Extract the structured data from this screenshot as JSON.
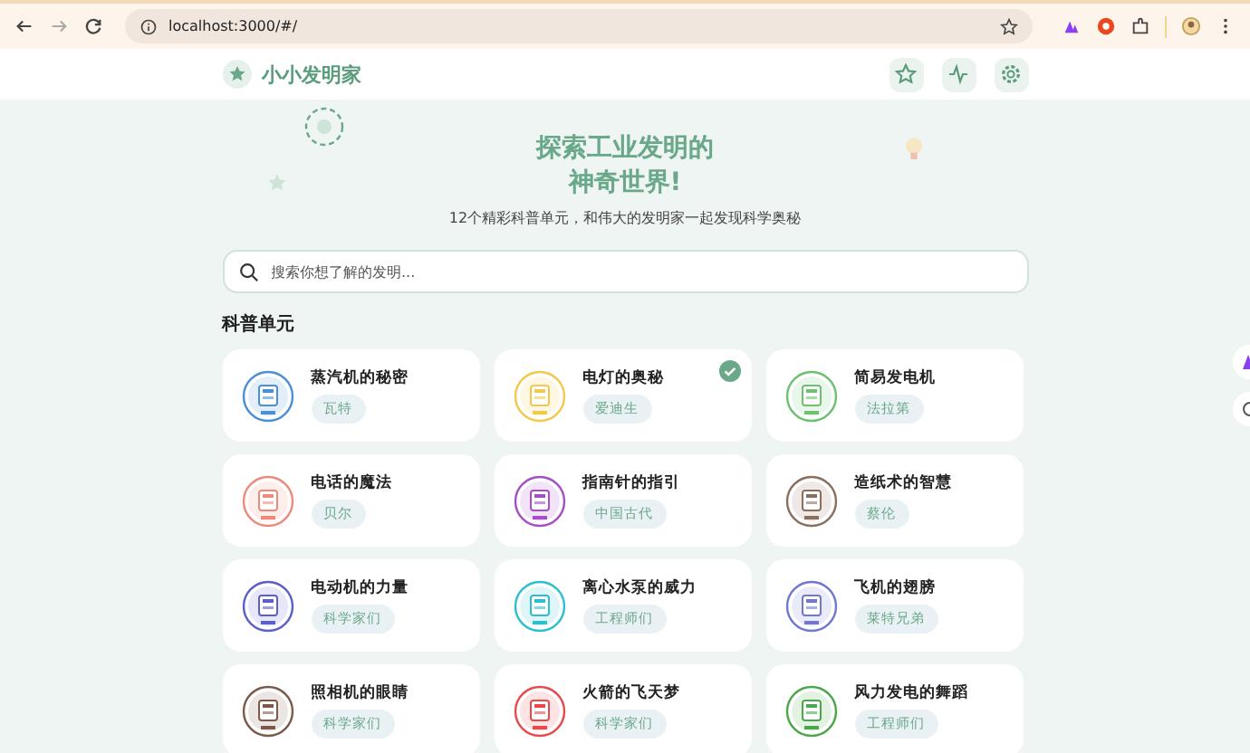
{
  "browser": {
    "url": "localhost:3000/#/"
  },
  "header": {
    "logo": "小小发明家"
  },
  "hero": {
    "title_line_1": "探索工业发明的",
    "title_line_2": "神奇世界!",
    "subtitle": "12个精彩科普单元，和伟大的发明家一起发现科学奥秘"
  },
  "search": {
    "placeholder": "搜索你想了解的发明..."
  },
  "section_title": "科普单元",
  "units": [
    {
      "title": "蒸汽机的秘密",
      "inventor": "瓦特",
      "color": "#4a90d9",
      "completed": false
    },
    {
      "title": "电灯的奥秘",
      "inventor": "爱迪生",
      "color": "#f2c94c",
      "completed": true
    },
    {
      "title": "简易发电机",
      "inventor": "法拉第",
      "color": "#6cc070",
      "completed": false
    },
    {
      "title": "电话的魔法",
      "inventor": "贝尔",
      "color": "#ef8a7a",
      "completed": false
    },
    {
      "title": "指南针的指引",
      "inventor": "中国古代",
      "color": "#a64dc7",
      "completed": false
    },
    {
      "title": "造纸术的智慧",
      "inventor": "蔡伦",
      "color": "#8c6e5d",
      "completed": false
    },
    {
      "title": "电动机的力量",
      "inventor": "科学家们",
      "color": "#5a5fc9",
      "completed": false
    },
    {
      "title": "离心水泵的威力",
      "inventor": "工程师们",
      "color": "#2bbfcf",
      "completed": false
    },
    {
      "title": "飞机的翅膀",
      "inventor": "莱特兄弟",
      "color": "#7078d0",
      "completed": false
    },
    {
      "title": "照相机的眼睛",
      "inventor": "科学家们",
      "color": "#7a5a4a",
      "completed": false
    },
    {
      "title": "火箭的飞天梦",
      "inventor": "科学家们",
      "color": "#e84a4a",
      "completed": false
    },
    {
      "title": "风力发电的舞蹈",
      "inventor": "工程师们",
      "color": "#4aa84a",
      "completed": false
    }
  ]
}
